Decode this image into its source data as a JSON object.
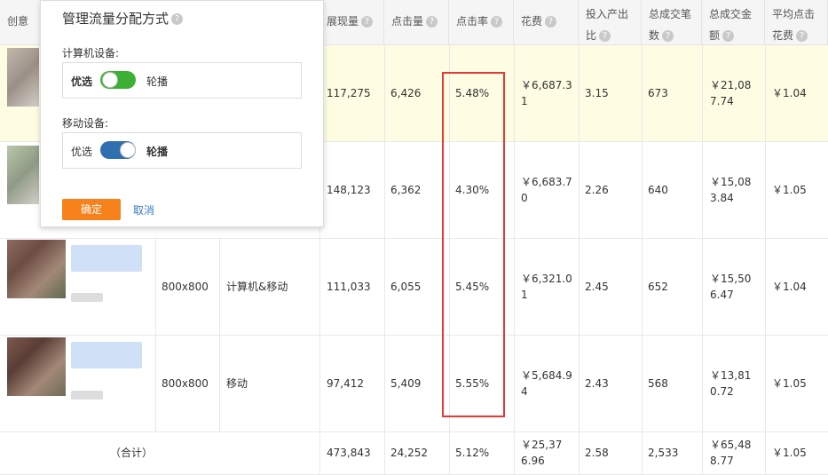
{
  "columns": [
    {
      "key": "creative",
      "label": "创意",
      "help": false
    },
    {
      "key": "impressions",
      "label": "展现量",
      "help": true
    },
    {
      "key": "clicks",
      "label": "点击量",
      "help": true
    },
    {
      "key": "ctr",
      "label": "点击率",
      "help": true
    },
    {
      "key": "cost",
      "label": "花费",
      "help": true
    },
    {
      "key": "roi",
      "label": "投入产出比",
      "line1": "投入产出",
      "line2": "比",
      "help": true
    },
    {
      "key": "orders",
      "label": "总成交笔数",
      "line1": "总成交笔",
      "line2": "数",
      "help": true
    },
    {
      "key": "gmv",
      "label": "总成交金额",
      "line1": "总成交金",
      "line2": "额",
      "help": true
    },
    {
      "key": "cpc",
      "label": "平均点击花费",
      "line1": "平均点击",
      "line2": "花费",
      "help": true
    }
  ],
  "rows": [
    {
      "size": "",
      "platform": "",
      "impressions": "117,275",
      "clicks": "6,426",
      "ctr": "5.48%",
      "cost1": "￥6,687.3",
      "cost2": "1",
      "roi": "3.15",
      "orders": "673",
      "gmv1": "￥21,08",
      "gmv2": "7.74",
      "cpc": "￥1.04"
    },
    {
      "size": "",
      "platform": "",
      "impressions": "148,123",
      "clicks": "6,362",
      "ctr": "4.30%",
      "cost1": "￥6,683.7",
      "cost2": "0",
      "roi": "2.26",
      "orders": "640",
      "gmv1": "￥15,08",
      "gmv2": "3.84",
      "cpc": "￥1.05"
    },
    {
      "size": "800x800",
      "platform": "计算机&移动",
      "impressions": "111,033",
      "clicks": "6,055",
      "ctr": "5.45%",
      "cost1": "￥6,321.0",
      "cost2": "1",
      "roi": "2.45",
      "orders": "652",
      "gmv1": "￥15,50",
      "gmv2": "6.47",
      "cpc": "￥1.04"
    },
    {
      "size": "800x800",
      "platform": "移动",
      "impressions": "97,412",
      "clicks": "5,409",
      "ctr": "5.55%",
      "cost1": "￥5,684.9",
      "cost2": "4",
      "roi": "2.43",
      "orders": "568",
      "gmv1": "￥13,81",
      "gmv2": "0.72",
      "cpc": "￥1.05"
    }
  ],
  "total": {
    "label": "（合计）",
    "impressions": "473,843",
    "clicks": "24,252",
    "ctr": "5.12%",
    "cost1": "￥25,37",
    "cost2": "6.96",
    "roi": "2.58",
    "orders": "2,533",
    "gmv1": "￥65,48",
    "gmv2": "8.77",
    "cpc": "￥1.05"
  },
  "popup": {
    "title": "管理流量分配方式",
    "computer_label": "计算机设备:",
    "mobile_label": "移动设备:",
    "option_preferred": "优选",
    "option_rotate": "轮播",
    "computer_mode": "优选",
    "mobile_mode": "轮播",
    "confirm": "确定",
    "cancel": "取消"
  },
  "colors": {
    "toggle_green": "#3cb034",
    "toggle_blue": "#2f6fb0",
    "confirm_orange": "#f7821b",
    "highlight_row": "#fefde3",
    "annotation_red": "#e53935"
  }
}
